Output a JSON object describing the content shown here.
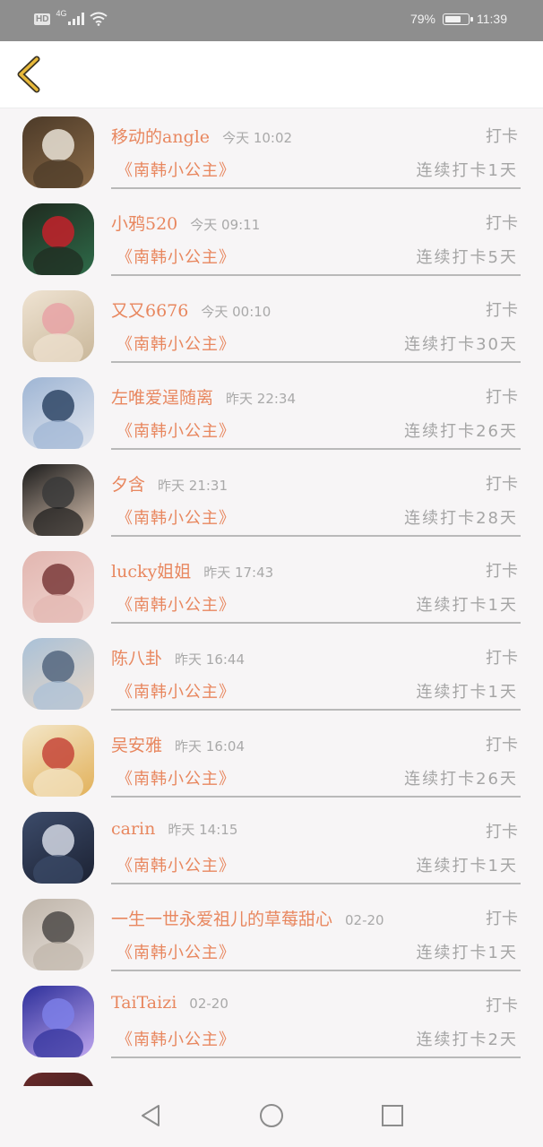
{
  "status_bar": {
    "hd_label": "HD",
    "network": "4G",
    "battery_percent": "79%",
    "battery_level": 0.79,
    "time": "11:39"
  },
  "header": {
    "back_icon": "chevron-left-icon",
    "accent_color": "#e8b93a"
  },
  "entries": [
    {
      "name": "移动的angle",
      "time": "今天 10:02",
      "action": "打卡",
      "book": "《南韩小公主》",
      "streak": "连续打卡1天"
    },
    {
      "name": "小鸦520",
      "time": "今天 09:11",
      "action": "打卡",
      "book": "《南韩小公主》",
      "streak": "连续打卡5天"
    },
    {
      "name": "又又6676",
      "time": "今天 00:10",
      "action": "打卡",
      "book": "《南韩小公主》",
      "streak": "连续打卡30天"
    },
    {
      "name": "左唯爱逞随离",
      "time": "昨天 22:34",
      "action": "打卡",
      "book": "《南韩小公主》",
      "streak": "连续打卡26天"
    },
    {
      "name": "夕含",
      "time": "昨天 21:31",
      "action": "打卡",
      "book": "《南韩小公主》",
      "streak": "连续打卡28天"
    },
    {
      "name": "lucky姐姐",
      "time": "昨天 17:43",
      "action": "打卡",
      "book": "《南韩小公主》",
      "streak": "连续打卡1天"
    },
    {
      "name": "陈八卦",
      "time": "昨天 16:44",
      "action": "打卡",
      "book": "《南韩小公主》",
      "streak": "连续打卡1天"
    },
    {
      "name": "吴安雅",
      "time": "昨天 16:04",
      "action": "打卡",
      "book": "《南韩小公主》",
      "streak": "连续打卡26天"
    },
    {
      "name": "carin",
      "time": "昨天 14:15",
      "action": "打卡",
      "book": "《南韩小公主》",
      "streak": "连续打卡1天"
    },
    {
      "name": "一生一世永爱祖儿的草莓甜心",
      "time": "02-20",
      "action": "打卡",
      "book": "《南韩小公主》",
      "streak": "连续打卡1天"
    },
    {
      "name": "TaiTaizi",
      "time": "02-20",
      "action": "打卡",
      "book": "《南韩小公主》",
      "streak": "连续打卡2天"
    }
  ],
  "nav": {
    "back": "triangle-back-icon",
    "home": "circle-home-icon",
    "recents": "square-recents-icon"
  }
}
